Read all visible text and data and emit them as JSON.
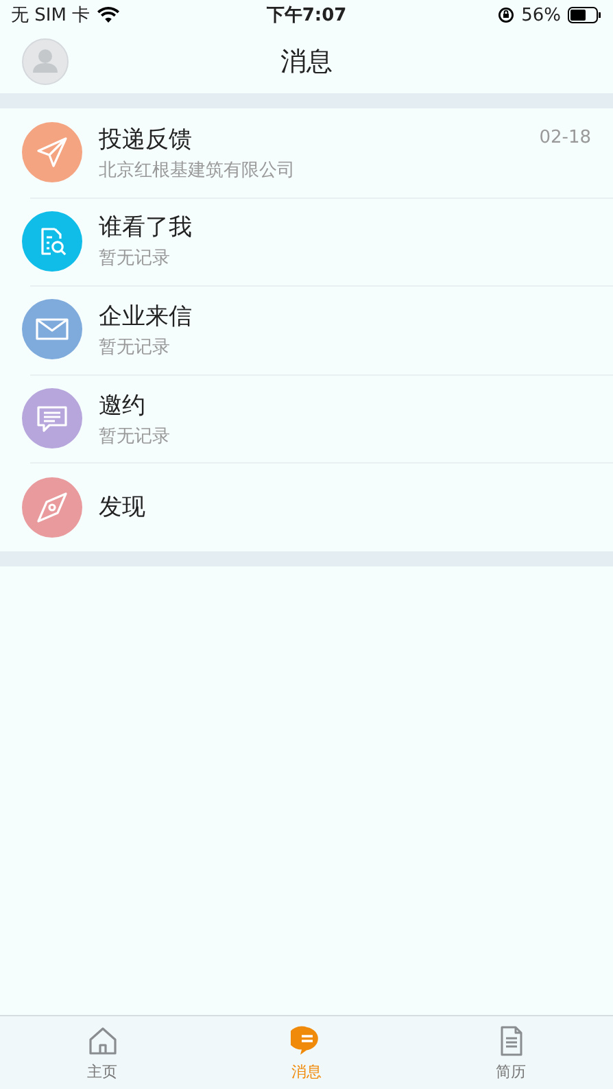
{
  "status_bar": {
    "carrier": "无 SIM 卡",
    "time": "下午7:07",
    "battery": "56%"
  },
  "header": {
    "title": "消息"
  },
  "messages": [
    {
      "kind": "send",
      "color": "#f5a481",
      "title": "投递反馈",
      "subtitle": "北京红根基建筑有限公司",
      "date": "02-18"
    },
    {
      "kind": "view",
      "color": "#10bde8",
      "title": "谁看了我",
      "subtitle": "暂无记录"
    },
    {
      "kind": "mail",
      "color": "#7eaadc",
      "title": "企业来信",
      "subtitle": "暂无记录"
    },
    {
      "kind": "chat",
      "color": "#b6a6dc",
      "title": "邀约",
      "subtitle": "暂无记录"
    },
    {
      "kind": "compass",
      "color": "#e99a9d",
      "title": "发现"
    }
  ],
  "tabs": [
    {
      "kind": "home",
      "label": "主页",
      "selected": false
    },
    {
      "kind": "message",
      "label": "消息",
      "selected": true
    },
    {
      "kind": "resume",
      "label": "简历",
      "selected": false
    }
  ]
}
